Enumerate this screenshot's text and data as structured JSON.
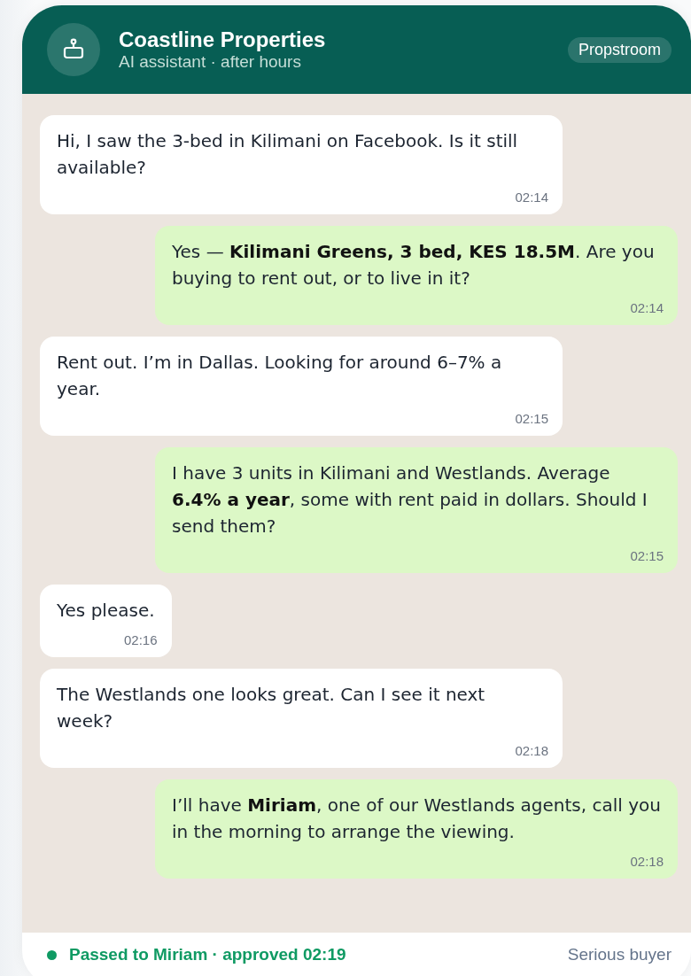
{
  "header": {
    "title": "Coastline Properties",
    "subtitle": "AI assistant · after hours",
    "badge": "Propstroom"
  },
  "messages": [
    {
      "kind": "incoming",
      "text": "Hi, I saw the 3-bed in Kilimani on Facebook. Is it still available?",
      "time": "02:14"
    },
    {
      "kind": "outgoing",
      "text": "Yes — **Kilimani Greens, 3 bed, KES 18.5M**. Are you buying to rent out, or to live in it?",
      "time": "02:14"
    },
    {
      "kind": "incoming",
      "text": "Rent out. I’m in Dallas. Looking for around 6–7% a year.",
      "time": "02:15"
    },
    {
      "kind": "outgoing",
      "text": "I have 3 units in Kilimani and Westlands. Average **6.4% a year**, some with rent paid in dollars. Should I send them?",
      "time": "02:15"
    },
    {
      "kind": "incoming",
      "text": "Yes please.",
      "time": "02:16"
    },
    {
      "kind": "incoming",
      "text": "The Westlands one looks great. Can I see it next week?",
      "time": "02:18"
    },
    {
      "kind": "outgoing",
      "text": "I’ll have **Miriam**, one of our Westlands agents, call you in the morning to arrange the viewing.",
      "time": "02:18"
    }
  ],
  "footer": {
    "status": {
      "text": "Passed to Miriam · approved 02:19",
      "color": "#0f9a63"
    },
    "tag": "Serious buyer"
  }
}
